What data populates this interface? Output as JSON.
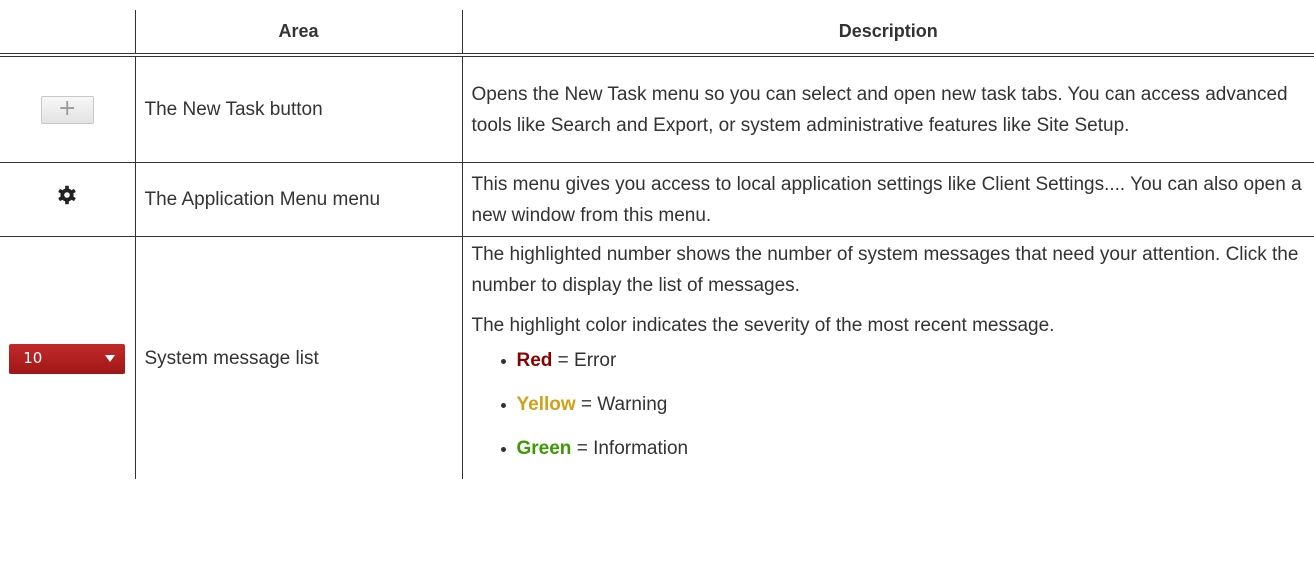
{
  "table": {
    "headers": {
      "icon": "",
      "area": "Area",
      "description": "Description"
    },
    "rows": [
      {
        "icon": "plus-icon",
        "icon_label": "+",
        "area": "The New Task button",
        "description": "Opens the New Task menu so you can select and open new task tabs. You can access advanced tools like Search and Export, or system administrative features like Site Setup."
      },
      {
        "icon": "gear-icon",
        "area": "The Application Menu menu",
        "description": "This menu gives you access to local application settings like Client Settings.... You can also open a new window from this menu."
      },
      {
        "icon": "system-message-badge",
        "badge_count": "10",
        "area": "System message list",
        "description_paragraphs": [
          "The highlighted number shows the number of system messages that need your attention. Click the number to display the list of messages.",
          "The highlight color indicates the severity of the most recent message."
        ],
        "severity_items": [
          {
            "word": "Red",
            "rest": " = Error",
            "color": "#8b0000"
          },
          {
            "word": "Yellow",
            "rest": " = Warning",
            "color": "#d4a017"
          },
          {
            "word": "Green",
            "rest": " = Information",
            "color": "#3a9b00"
          }
        ]
      }
    ]
  },
  "colors": {
    "badge_red": "#b01f1f",
    "text": "#333333"
  }
}
